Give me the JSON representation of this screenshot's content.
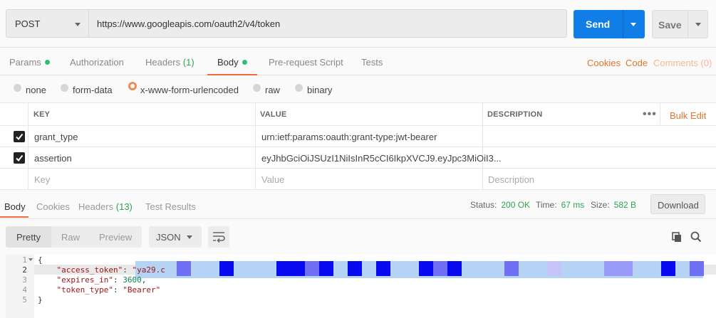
{
  "request": {
    "method": "POST",
    "url": "https://www.googleapis.com/oauth2/v4/token",
    "send_label": "Send",
    "save_label": "Save"
  },
  "request_tabs": {
    "params": "Params",
    "authorization": "Authorization",
    "headers": "Headers",
    "headers_count": "(1)",
    "body": "Body",
    "prerequest": "Pre-request Script",
    "tests": "Tests",
    "cookies": "Cookies",
    "code": "Code",
    "comments": "Comments (0)"
  },
  "body_types": {
    "none": "none",
    "form_data": "form-data",
    "urlencoded": "x-www-form-urlencoded",
    "raw": "raw",
    "binary": "binary",
    "selected": "x-www-form-urlencoded"
  },
  "params_table": {
    "headers": {
      "key": "KEY",
      "value": "VALUE",
      "description": "DESCRIPTION"
    },
    "bulk_edit": "Bulk Edit",
    "rows": [
      {
        "checked": true,
        "key": "grant_type",
        "value": "urn:ietf:params:oauth:grant-type:jwt-bearer",
        "description": ""
      },
      {
        "checked": true,
        "key": "assertion",
        "value": "eyJhbGciOiJSUzI1NiIsInR5cCI6IkpXVCJ9.eyJpc3MiOiI3...",
        "description": ""
      }
    ],
    "placeholders": {
      "key": "Key",
      "value": "Value",
      "description": "Description"
    }
  },
  "response": {
    "tabs": {
      "body": "Body",
      "cookies": "Cookies",
      "headers": "Headers",
      "headers_count": "(13)",
      "test_results": "Test Results"
    },
    "status_label": "Status:",
    "status_value": "200 OK",
    "time_label": "Time:",
    "time_value": "67 ms",
    "size_label": "Size:",
    "size_value": "582 B",
    "download_label": "Download",
    "view_modes": {
      "pretty": "Pretty",
      "raw": "Raw",
      "preview": "Preview"
    },
    "format": "JSON",
    "line_numbers": [
      "1",
      "2",
      "3",
      "4",
      "5"
    ],
    "code": {
      "line1": "{",
      "access_token_key": "\"access_token\"",
      "access_token_prefix": "\"ya29.c",
      "expires_key": "\"expires_in\"",
      "expires_value": "3600",
      "token_type_key": "\"token_type\"",
      "token_type_value": "\"Bearer\"",
      "line5": "}"
    }
  },
  "icons": [
    "chevron-down-icon",
    "checkbox-checked-icon",
    "more-horizontal-icon",
    "wrap-lines-icon",
    "copy-icon",
    "search-icon",
    "fold-arrow-icon"
  ],
  "colors": {
    "send": "#107ee6",
    "accent": "#f26b3a",
    "link": "#e0762f",
    "success": "#2ea44f",
    "selection": "#b5d3f5"
  }
}
